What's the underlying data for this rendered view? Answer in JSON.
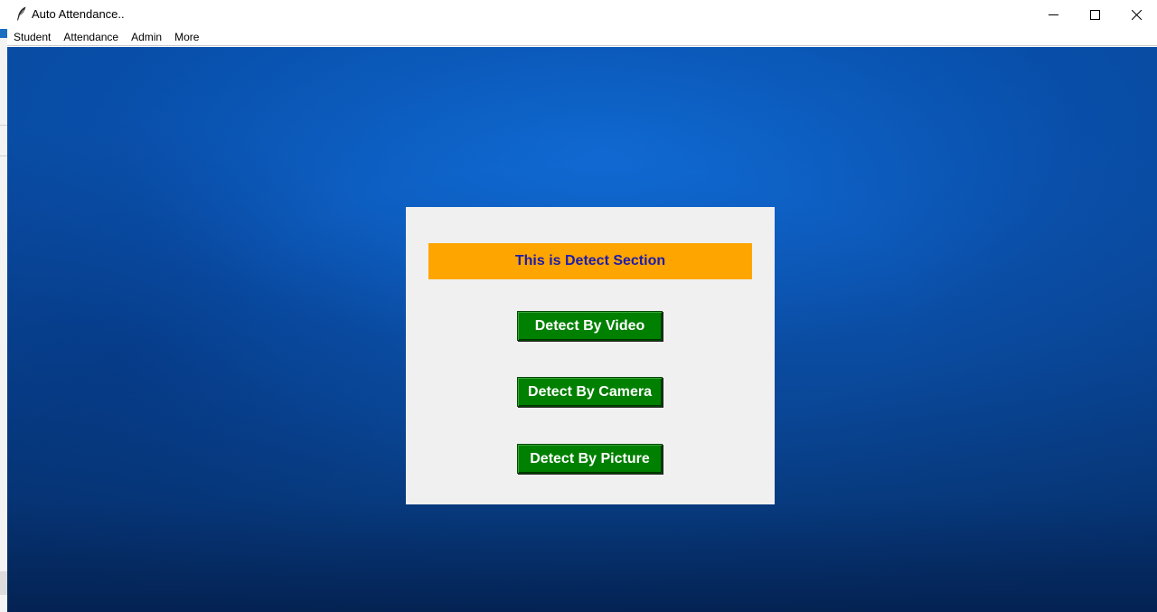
{
  "window": {
    "title": "Auto Attendance..",
    "icon": "feather-icon",
    "controls": {
      "minimize": "minimize-icon",
      "maximize": "maximize-icon",
      "close": "close-icon"
    }
  },
  "menubar": {
    "items": [
      {
        "label": "Student"
      },
      {
        "label": "Attendance"
      },
      {
        "label": "Admin"
      },
      {
        "label": "More"
      }
    ]
  },
  "detect_panel": {
    "header": "This is Detect Section",
    "buttons": {
      "video": "Detect By Video",
      "camera": "Detect By Camera",
      "picture": "Detect By Picture"
    }
  },
  "colors": {
    "header_background": "#ffa500",
    "header_text": "#1c1caa",
    "button_background": "#008000",
    "button_text": "#ffffff",
    "panel_background": "#f0f0f0",
    "desktop_background": "#0b55b4"
  }
}
